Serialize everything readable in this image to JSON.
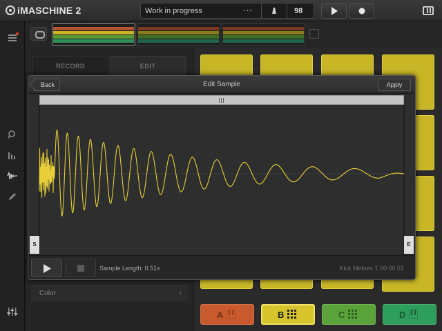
{
  "topbar": {
    "app_name": "iMASCHINE 2",
    "project_title": "Work in progress",
    "bpm": "98"
  },
  "left_panel": {
    "record_label": "RECORD",
    "edit_label": "EDIT",
    "color_label": "Color"
  },
  "group_buttons": [
    {
      "letter": "A",
      "color": "#c85a2e"
    },
    {
      "letter": "B",
      "color": "#d7c42c"
    },
    {
      "letter": "C",
      "color": "#5aa33a"
    },
    {
      "letter": "D",
      "color": "#2e9e5c"
    }
  ],
  "pads": {
    "color": "#c9b627"
  },
  "modal": {
    "title": "Edit Sample",
    "back_label": "Back",
    "apply_label": "Apply",
    "start_handle": "S",
    "end_handle": "E",
    "sample_length": "Sample Length: 0.51s",
    "sample_info": "Kick Meloes 1  00:00.51",
    "waveform_color": "#e8cf3a"
  }
}
